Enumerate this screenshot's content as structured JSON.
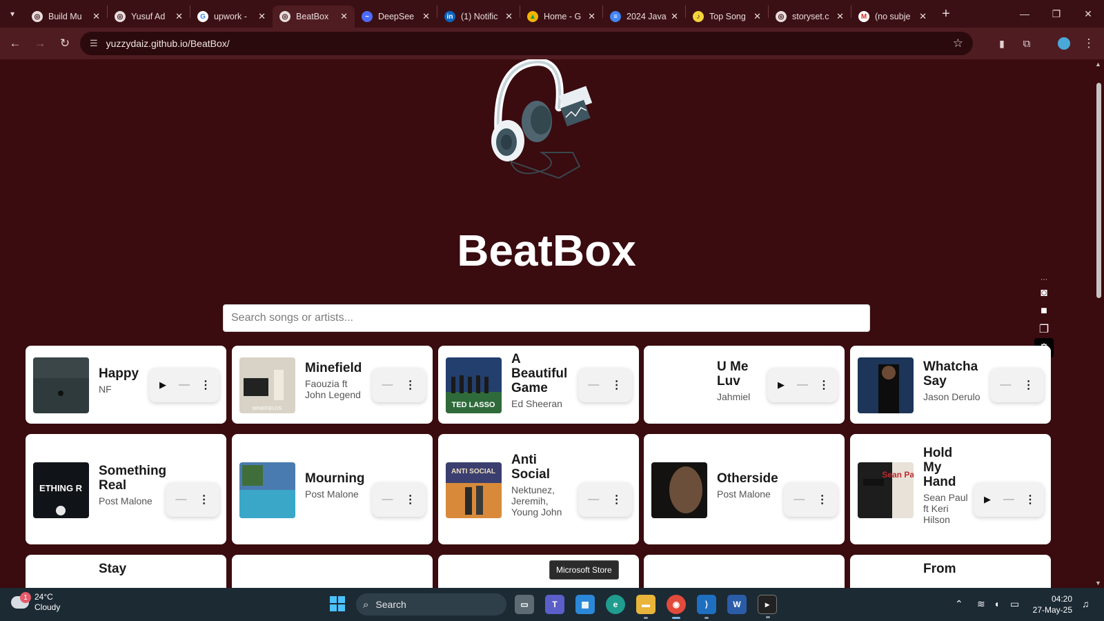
{
  "browser": {
    "tabs": [
      {
        "title": "Build Mu",
        "favicon": "chatgpt-icon",
        "active": false
      },
      {
        "title": "Yusuf Ad",
        "favicon": "chatgpt-icon",
        "active": false
      },
      {
        "title": "upwork -",
        "favicon": "google-icon",
        "active": false
      },
      {
        "title": "BeatBox",
        "favicon": "globe-icon",
        "active": true
      },
      {
        "title": "DeepSee",
        "favicon": "deepseek-icon",
        "active": false
      },
      {
        "title": "(1) Notific",
        "favicon": "linkedin-icon",
        "active": false
      },
      {
        "title": "Home - G",
        "favicon": "google-drive-icon",
        "active": false
      },
      {
        "title": "2024 Java",
        "favicon": "google-docs-icon",
        "active": false
      },
      {
        "title": "Top Song",
        "favicon": "spotify-icon",
        "active": false
      },
      {
        "title": "storyset.c",
        "favicon": "globe-icon",
        "active": false
      },
      {
        "title": "(no subje",
        "favicon": "gmail-icon",
        "active": false
      }
    ],
    "url": "yuzzydaiz.github.io/BeatBox/"
  },
  "app": {
    "title": "BeatBox",
    "search_placeholder": "Search songs or artists..."
  },
  "songs": [
    {
      "title": "Happy",
      "artist": "NF",
      "play": true
    },
    {
      "title": "Minefield",
      "artist": "Faouzia ft John Legend",
      "play": false,
      "cover_text": "MINEFIELDS"
    },
    {
      "title": "A Beautiful Game",
      "artist": "Ed Sheeran",
      "play": false,
      "cover_text": "TED LASSO"
    },
    {
      "title": "U Me Luv",
      "artist": "Jahmiel",
      "play": true
    },
    {
      "title": "Whatcha Say",
      "artist": "Jason Derulo",
      "play": false
    },
    {
      "title": "Something Real",
      "artist": "Post Malone",
      "play": false,
      "cover_text": "ETHING R"
    },
    {
      "title": "Mourning",
      "artist": "Post Malone",
      "play": false
    },
    {
      "title": "Anti Social",
      "artist": "Nektunez, Jeremih, Young John",
      "play": false,
      "cover_text": "ANTI SOCIAL"
    },
    {
      "title": "Otherside",
      "artist": "Post Malone",
      "play": false
    },
    {
      "title": "Hold My Hand",
      "artist": "Sean Paul ft Keri Hilson",
      "play": true,
      "cover_text": "Sean Paul"
    },
    {
      "title": "Stay",
      "artist": "",
      "play": false
    },
    {
      "title": "",
      "artist": "",
      "play": false
    },
    {
      "title": "",
      "artist": "",
      "play": false
    },
    {
      "title": "",
      "artist": "",
      "play": false
    },
    {
      "title": "From",
      "artist": "",
      "play": false
    }
  ],
  "tooltip": "Microsoft Store",
  "taskbar": {
    "weather_temp": "24°C",
    "weather_desc": "Cloudy",
    "weather_badge": "1",
    "search_label": "Search",
    "time": "04:20",
    "date": "27-May-25"
  },
  "colors": {
    "page_bg": "#3a0b0f",
    "card_bg": "#ffffff",
    "tab_active": "#4f1c21"
  }
}
